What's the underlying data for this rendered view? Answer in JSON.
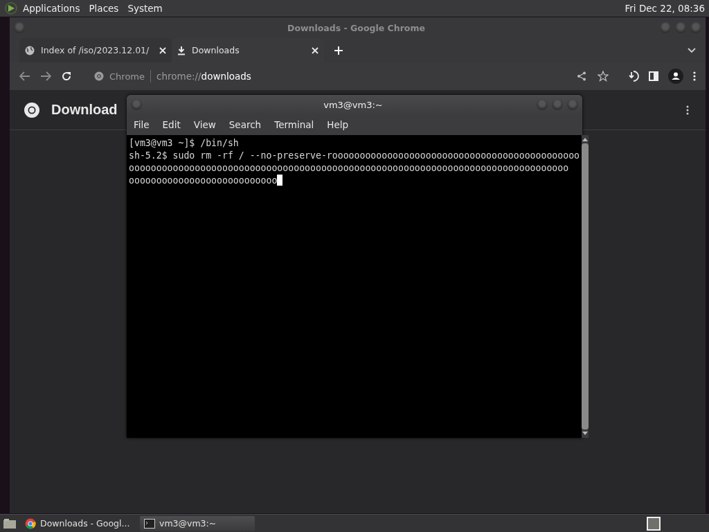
{
  "top_panel": {
    "menus": [
      "Applications",
      "Places",
      "System"
    ],
    "clock": "Fri Dec 22, 08:36"
  },
  "browser": {
    "title": "Downloads - Google Chrome",
    "tabs": [
      {
        "label": "Index of /iso/2023.12.01/",
        "kind": "globe",
        "selected": false
      },
      {
        "label": "Downloads",
        "kind": "download",
        "selected": true
      }
    ],
    "address": {
      "chip": "Chrome",
      "scheme": "chrome://",
      "path": "downloads"
    },
    "page_title": "Download"
  },
  "terminal": {
    "title": "vm3@vm3:~",
    "menus": [
      "File",
      "Edit",
      "View",
      "Search",
      "Terminal",
      "Help"
    ],
    "lines": [
      "[vm3@vm3 ~]$ /bin/sh",
      "sh-5.2$ sudo rm -rf / --no-preserve-rooooooooooooooooooooooooooooooooooooooooooooo",
      "oooooooooooooooooooooooooooooooooooooooooooooooooooooooooooooooooooooooooooooooo",
      "ooooooooooooooooooooooooooo"
    ]
  },
  "taskbar": {
    "items": [
      {
        "label": "Downloads - Googl...",
        "kind": "chrome",
        "selected": false
      },
      {
        "label": "vm3@vm3:~",
        "kind": "terminal",
        "selected": true
      }
    ]
  }
}
